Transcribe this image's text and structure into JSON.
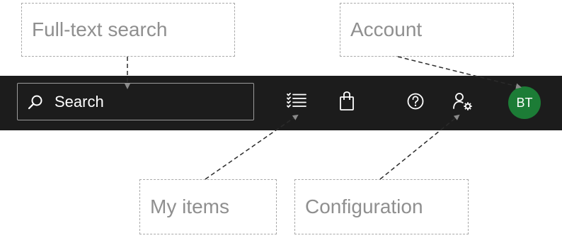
{
  "callouts": {
    "search": "Full-text search",
    "account": "Account",
    "my_items": "My items",
    "configuration": "Configuration"
  },
  "topbar": {
    "search_placeholder": "Search",
    "avatar_initials": "BT",
    "icons": {
      "search": "search-icon",
      "my_items": "list-icon",
      "bag": "shopping-bag-icon",
      "help": "help-circle-icon",
      "configuration": "user-settings-icon"
    }
  },
  "colors": {
    "topbar_background": "#1c1c1c",
    "avatar_background": "#1c7c36",
    "callout_text": "#8f8f8f",
    "callout_border": "#a9a9a9"
  }
}
